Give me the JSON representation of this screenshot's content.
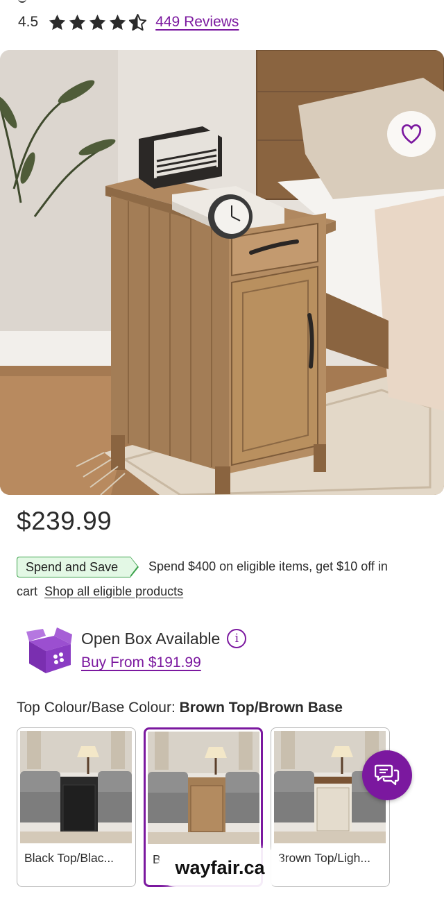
{
  "rating": {
    "value": "4.5",
    "stars_filled": 4.5,
    "stars_total": 5,
    "reviews_link": "449 Reviews"
  },
  "gallery": {
    "image_count": 5,
    "active_index": 1,
    "favorite_icon": "heart-outline-icon"
  },
  "price": "$239.99",
  "promo": {
    "tag": "Spend and Save",
    "text": "Spend $400 on eligible items, get $10 off in",
    "text_cont": "cart",
    "link": "Shop all eligible products"
  },
  "open_box": {
    "icon": "open-box-icon",
    "title": "Open Box Available",
    "info_glyph": "i",
    "link": "Buy From $191.99"
  },
  "colour": {
    "label": "Top Colour/Base Colour:",
    "selected": "Brown Top/Brown Base",
    "options": [
      {
        "caption": "Black Top/Blac..."
      },
      {
        "caption": "B"
      },
      {
        "caption": "3rown Top/Ligh..."
      }
    ]
  },
  "chat": {
    "icon": "chat-bubbles-icon"
  },
  "watermark": "wayfair.ca",
  "colors": {
    "accent": "#7b189f",
    "promo_bg": "#e3f8e5",
    "promo_border": "#3aa14a",
    "text": "#2b2b2b"
  }
}
